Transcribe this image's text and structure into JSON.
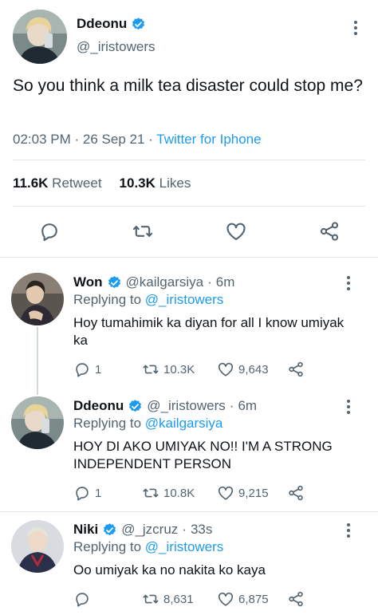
{
  "main_tweet": {
    "display_name": "Ddeonu",
    "handle": "@_iristowers",
    "text": "So you think a milk tea disaster could stop me?",
    "time": "02:03 PM",
    "date": "26 Sep 21",
    "client": "Twitter for Iphone",
    "retweets_count": "11.6K",
    "retweets_label": "Retweet",
    "likes_count": "10.3K",
    "likes_label": "Likes"
  },
  "replies": [
    {
      "display_name": "Won",
      "handle": "@kailgarsiya",
      "time": "6m",
      "replying_label": "Replying to",
      "replying_to": "@_iristowers",
      "text": "Hoy tumahimik ka diyan for all I know umiyak ka",
      "reply_count": "1",
      "retweet_count": "10.3K",
      "like_count": "9,643"
    },
    {
      "display_name": "Ddeonu",
      "handle": "@_iristowers",
      "time": "6m",
      "replying_label": "Replying to",
      "replying_to": "@kailgarsiya",
      "text": "HOY DI AKO UMIYAK NO!! I'M A STRONG INDEPENDENT PERSON",
      "reply_count": "1",
      "retweet_count": "10.8K",
      "like_count": "9,215"
    },
    {
      "display_name": "Niki",
      "handle": "@_jzcruz",
      "time": "33s",
      "replying_label": "Replying to",
      "replying_to": "@_iristowers",
      "text": "Oo umiyak ka no nakita ko kaya",
      "reply_count": "",
      "retweet_count": "8,631",
      "like_count": "6,875"
    }
  ],
  "separators": {
    "dot": "·"
  },
  "icons": [
    "verified-badge-icon",
    "more-icon",
    "reply-icon",
    "retweet-icon",
    "like-icon",
    "share-icon"
  ],
  "colors": {
    "accent": "#1d9bf0",
    "secondary_text": "#536471",
    "primary_text": "#0f1419",
    "border": "#e1e8ed"
  }
}
